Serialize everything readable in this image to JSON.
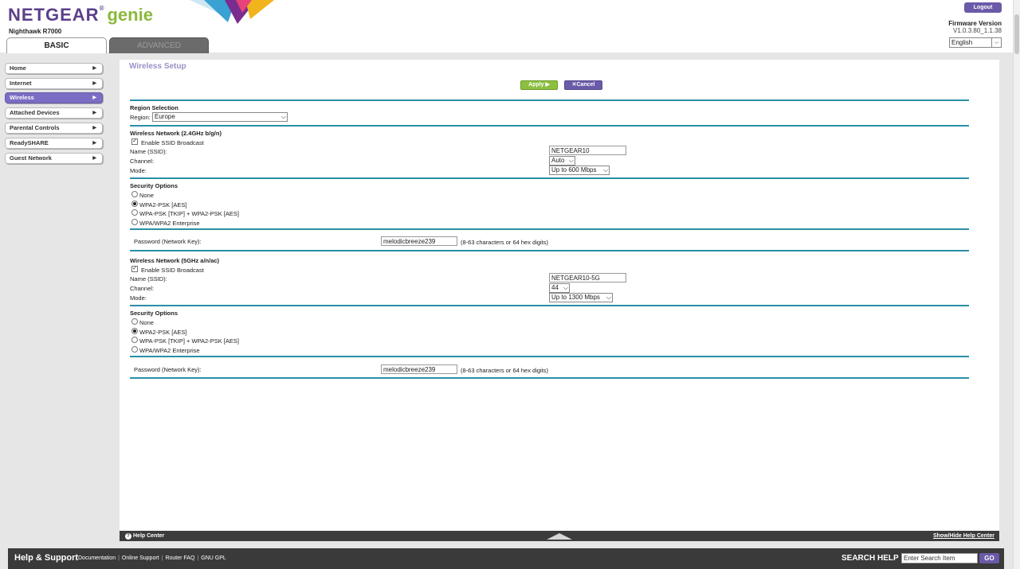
{
  "header": {
    "brand": "NETGEAR",
    "product": "genie",
    "model": "Nighthawk R7000",
    "tabs": {
      "basic": "BASIC",
      "advanced": "ADVANCED"
    },
    "logout": "Logout",
    "firmware_title": "Firmware Version",
    "firmware_value": "V1.0.3.80_1.1.38",
    "language": "English"
  },
  "sidebar": {
    "items": [
      {
        "label": "Home",
        "active": false
      },
      {
        "label": "Internet",
        "active": false
      },
      {
        "label": "Wireless",
        "active": true
      },
      {
        "label": "Attached Devices",
        "active": false
      },
      {
        "label": "Parental Controls",
        "active": false
      },
      {
        "label": "ReadySHARE",
        "active": false
      },
      {
        "label": "Guest Network",
        "active": false
      }
    ]
  },
  "main": {
    "title": "Wireless Setup",
    "apply": "Apply ▶",
    "cancel": "Cancel",
    "region": {
      "heading": "Region Selection",
      "label": "Region:",
      "value": "Europe"
    },
    "net24": {
      "heading": "Wireless Network (2.4GHz b/g/n)",
      "broadcast_label": "Enable SSID Broadcast",
      "broadcast_checked": true,
      "ssid_label": "Name (SSID):",
      "ssid_value": "NETGEAR10",
      "channel_label": "Channel:",
      "channel_value": "Auto",
      "mode_label": "Mode:",
      "mode_value": "Up to 600 Mbps",
      "security_heading": "Security Options",
      "security_options": [
        "None",
        "WPA2-PSK [AES]",
        "WPA-PSK [TKIP] + WPA2-PSK [AES]",
        "WPA/WPA2 Enterprise"
      ],
      "security_selected": 1,
      "password_label": "Password (Network Key):",
      "password_value": "melodicbreeze239",
      "password_hint": "(8-63 characters or 64 hex digits)"
    },
    "net5": {
      "heading": "Wireless Network (5GHz a/n/ac)",
      "broadcast_label": "Enable SSID Broadcast",
      "broadcast_checked": true,
      "ssid_label": "Name (SSID):",
      "ssid_value": "NETGEAR10-5G",
      "channel_label": "Channel:",
      "channel_value": "44",
      "mode_label": "Mode:",
      "mode_value": "Up to 1300 Mbps",
      "security_heading": "Security Options",
      "security_options": [
        "None",
        "WPA2-PSK [AES]",
        "WPA-PSK [TKIP] + WPA2-PSK [AES]",
        "WPA/WPA2 Enterprise"
      ],
      "security_selected": 1,
      "password_label": "Password (Network Key):",
      "password_value": "melodicbreeze239",
      "password_hint": "(8-63 characters or 64 hex digits)"
    }
  },
  "helpbar": {
    "help_center": "Help Center",
    "toggle": "Show/Hide Help Center"
  },
  "footer": {
    "title": "Help & Support",
    "links": [
      "Documentation",
      "Online Support",
      "Router FAQ",
      "GNU GPL"
    ],
    "search_label": "SEARCH HELP",
    "search_placeholder": "Enter Search Item",
    "go": "GO"
  },
  "colors": {
    "accent_purple": "#6a5aa8",
    "accent_green": "#8cbf3f",
    "divider_teal": "#2a8fa8"
  }
}
